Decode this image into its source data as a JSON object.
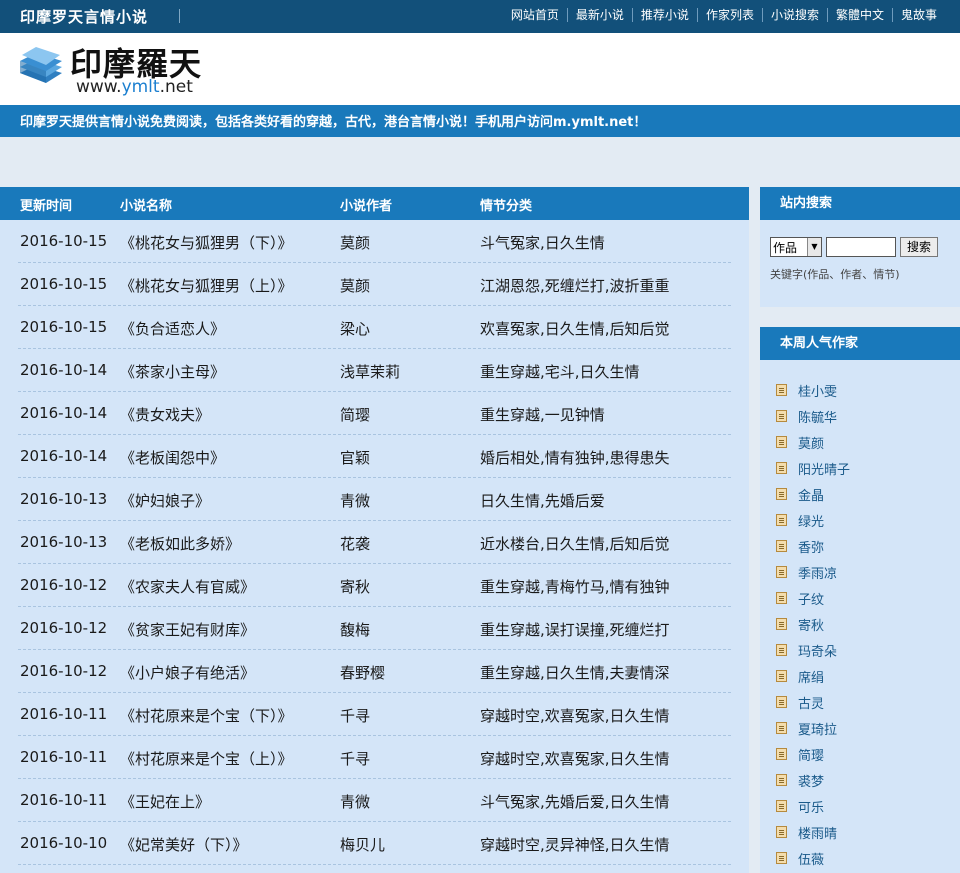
{
  "topbar": {
    "site_name": "印摩罗天言情小说",
    "nav": [
      "网站首页",
      "最新小说",
      "推荐小说",
      "作家列表",
      "小说搜索",
      "繁體中文",
      "鬼故事"
    ]
  },
  "header": {
    "logo_title": "印摩羅天",
    "domain_prefix": "www.",
    "domain_highlight": "ymlt",
    "domain_suffix": ".net"
  },
  "banner": {
    "text": "印摩罗天提供言情小说免费阅读，包括各类好看的穿越，古代，港台言情小说！手机用户访问m.ymlt.net！"
  },
  "list": {
    "headers": {
      "date": "更新时间",
      "title": "小说名称",
      "author": "小说作者",
      "genre": "情节分类"
    },
    "rows": [
      {
        "date": "2016-10-15",
        "title": "《桃花女与狐狸男（下）》",
        "author": "莫颜",
        "genre": "斗气冤家,日久生情"
      },
      {
        "date": "2016-10-15",
        "title": "《桃花女与狐狸男（上）》",
        "author": "莫颜",
        "genre": "江湖恩怨,死缠烂打,波折重重"
      },
      {
        "date": "2016-10-15",
        "title": "《负合适恋人》",
        "author": "梁心",
        "genre": "欢喜冤家,日久生情,后知后觉"
      },
      {
        "date": "2016-10-14",
        "title": "《茶家小主母》",
        "author": "浅草茉莉",
        "genre": "重生穿越,宅斗,日久生情"
      },
      {
        "date": "2016-10-14",
        "title": "《贵女戏夫》",
        "author": "简璎",
        "genre": "重生穿越,一见钟情"
      },
      {
        "date": "2016-10-14",
        "title": "《老板闺怨中》",
        "author": "官颖",
        "genre": "婚后相处,情有独钟,患得患失"
      },
      {
        "date": "2016-10-13",
        "title": "《妒妇娘子》",
        "author": "青微",
        "genre": "日久生情,先婚后爱"
      },
      {
        "date": "2016-10-13",
        "title": "《老板如此多娇》",
        "author": "花袭",
        "genre": "近水楼台,日久生情,后知后觉"
      },
      {
        "date": "2016-10-12",
        "title": "《农家夫人有官威》",
        "author": "寄秋",
        "genre": "重生穿越,青梅竹马,情有独钟"
      },
      {
        "date": "2016-10-12",
        "title": "《贫家王妃有财库》",
        "author": "馥梅",
        "genre": "重生穿越,误打误撞,死缠烂打"
      },
      {
        "date": "2016-10-12",
        "title": "《小户娘子有绝活》",
        "author": "春野樱",
        "genre": "重生穿越,日久生情,夫妻情深"
      },
      {
        "date": "2016-10-11",
        "title": "《村花原来是个宝（下）》",
        "author": "千寻",
        "genre": "穿越时空,欢喜冤家,日久生情"
      },
      {
        "date": "2016-10-11",
        "title": "《村花原来是个宝（上）》",
        "author": "千寻",
        "genre": "穿越时空,欢喜冤家,日久生情"
      },
      {
        "date": "2016-10-11",
        "title": "《王妃在上》",
        "author": "青微",
        "genre": "斗气冤家,先婚后爱,日久生情"
      },
      {
        "date": "2016-10-10",
        "title": "《妃常美好（下）》",
        "author": "梅贝儿",
        "genre": "穿越时空,灵异神怪,日久生情"
      }
    ]
  },
  "search": {
    "title": "站内搜索",
    "select_value": "作品",
    "button_label": "搜索",
    "hint": "关键字(作品、作者、情节)"
  },
  "authors": {
    "title": "本周人气作家",
    "items": [
      "桂小雯",
      "陈毓华",
      "莫颜",
      "阳光晴子",
      "金晶",
      "绿光",
      "香弥",
      "季雨凉",
      "子纹",
      "寄秋",
      "玛奇朵",
      "席绢",
      "古灵",
      "夏琦拉",
      "简璎",
      "裘梦",
      "可乐",
      "楼雨晴",
      "伍薇"
    ]
  }
}
